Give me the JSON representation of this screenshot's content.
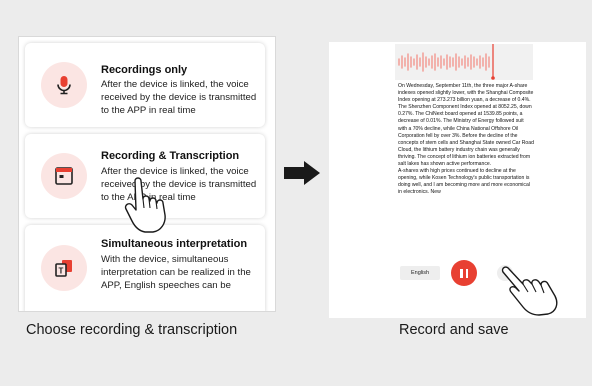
{
  "left_panel": {
    "cards": [
      {
        "title": "Recordings only",
        "description": "After the device is linked, the voice received by the device is transmitted to the APP in real time",
        "icon": "microphone-icon"
      },
      {
        "title": "Recording & Transcription",
        "description": "After the device is linked, the voice received by the device is transmitted to the APP in real time",
        "icon": "transcription-window-icon"
      },
      {
        "title": "Simultaneous interpretation",
        "description": "With the device, simultaneous interpretation can be realized in the APP, English speeches can be",
        "icon": "translation-icon"
      }
    ],
    "caption": "Choose recording & transcription"
  },
  "right_panel": {
    "transcript": [
      "On Wednesday, September 11th, the three major A-share indexes opened slightly lower, with the Shanghai Composite Index opening at 273.273 billion yuan, a decrease of 0.4%. The Shenzhen Component Index opened at 8052.25, down 0.27%. The ChiNext board opened at 1539.85 points, a decrease of 0.01%. The Ministry of Energy followed suit with a 70% decline, while China National Offshore Oil Corporation fell by over 3%. Before the decline of the concepts of stem cells and Shanghai State owned Car Road Cloud, the lithium battery industry chain was generally thriving. The concept of lithium ion batteries extracted from salt lakes has shown active performance.",
      "A-shares with high prices continued to decline at the opening, while Kosen Technology's public transportation is doing well, and I am becoming more and more economical in electronics. New"
    ],
    "language_button": "English",
    "caption": "Record and save"
  },
  "colors": {
    "accent": "#e84032",
    "icon_bg": "#fbe5e3",
    "waveform": "#f2a39c",
    "page_bg": "#ececec"
  }
}
